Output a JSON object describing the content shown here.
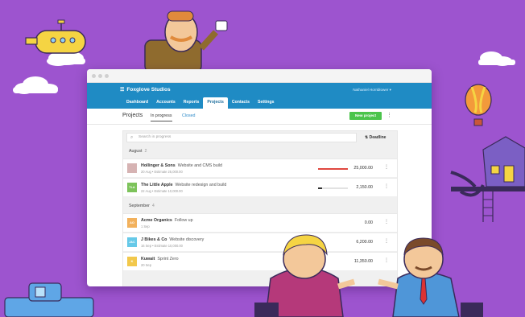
{
  "app": {
    "org_name": "Foxglove Studios",
    "user_name": "Nathaniel Hornblower ▾",
    "nav": [
      {
        "label": "Dashboard",
        "active": false
      },
      {
        "label": "Accounts",
        "active": false
      },
      {
        "label": "Reports",
        "active": false
      },
      {
        "label": "Projects",
        "active": true
      },
      {
        "label": "Contacts",
        "active": false
      },
      {
        "label": "Settings",
        "active": false
      }
    ]
  },
  "subheader": {
    "title": "Projects",
    "tabs": [
      {
        "label": "In progress",
        "active": true
      },
      {
        "label": "Closed",
        "active": false
      }
    ],
    "new_button": "New project"
  },
  "search": {
    "placeholder": "Search in progress",
    "sort_label": "⇅ Deadline"
  },
  "groups": [
    {
      "month": "August",
      "count": "2",
      "projects": [
        {
          "avatar": "",
          "avatar_color": "#d6b3b3",
          "client": "Hollinger & Sons",
          "name": "Website and CMS build",
          "meta": "20 Aug • Estimate 25,000.00",
          "amount": "25,000.00",
          "progress": 1.0,
          "progress_color": "#e0483f"
        },
        {
          "avatar": "TLA",
          "avatar_color": "#7dc35b",
          "client": "The Little Apple",
          "name": "Website redesign and build",
          "meta": "22 Aug • Estimate 10,000.00",
          "amount": "2,150.00",
          "progress": 0.14,
          "progress_color": "#333333"
        }
      ]
    },
    {
      "month": "September",
      "count": "4",
      "projects": [
        {
          "avatar": "AO",
          "avatar_color": "#f2b15c",
          "client": "Acme Organics",
          "name": "Follow up",
          "meta": "1 Sep",
          "amount": "0.00",
          "progress": 0,
          "progress_color": "#333333"
        },
        {
          "avatar": "J&C",
          "avatar_color": "#66c9e8",
          "client": "J Bikes & Co",
          "name": "Website discovery",
          "meta": "16 Sep • Estimate 10,000.00",
          "amount": "6,200.00",
          "progress": 0,
          "progress_color": "#333333"
        },
        {
          "avatar": "K",
          "avatar_color": "#f2c84b",
          "client": "Kuwait",
          "name": "Sprint Zero",
          "meta": "20 Sep",
          "amount": "11,350.00",
          "progress": 0,
          "progress_color": "#333333"
        }
      ]
    }
  ],
  "icons": {
    "menu": "hamburger-icon",
    "search": "magnifier-icon",
    "more": "kebab-icon"
  },
  "colors": {
    "background": "#9d54cf",
    "topbar": "#1f8bc4",
    "new_button": "#4bc44b"
  }
}
